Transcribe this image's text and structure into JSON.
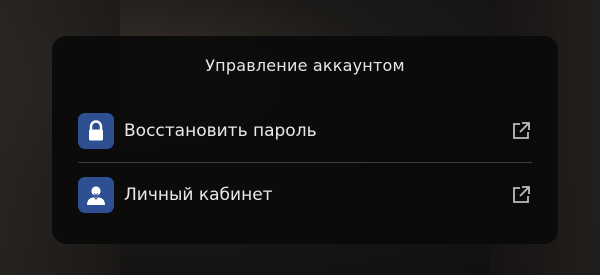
{
  "panel": {
    "title": "Управление аккаунтом",
    "items": [
      {
        "label": "Восстановить пароль",
        "icon": "lock-icon",
        "action_icon": "external-link-icon"
      },
      {
        "label": "Личный кабинет",
        "icon": "user-icon",
        "action_icon": "external-link-icon"
      }
    ]
  },
  "colors": {
    "icon_bg": "#2e4f91",
    "panel_bg": "#0a0a0a",
    "text": "#e9e9e9",
    "divider": "#3d3d3d"
  }
}
